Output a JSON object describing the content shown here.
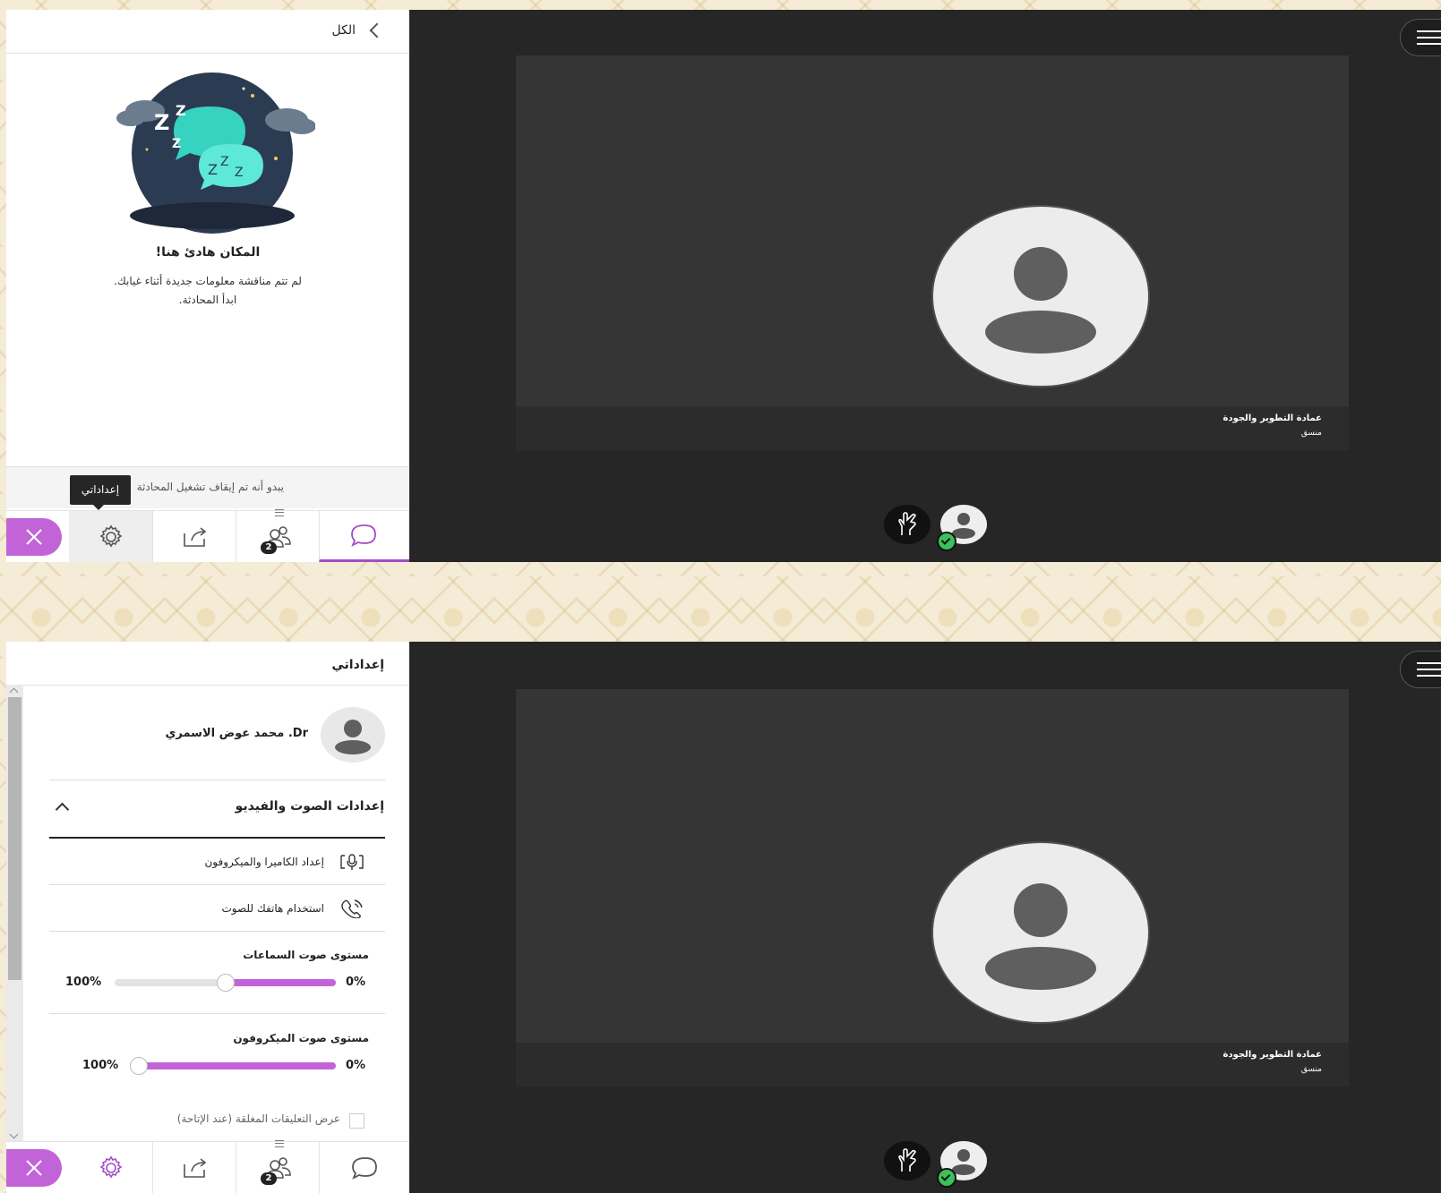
{
  "top": {
    "chat_header": {
      "back_label": "الكل"
    },
    "empty_state": {
      "title": "المكان هادئ هنا!",
      "line1": "لم تتم مناقشة معلومات جديدة أثناء غيابك.",
      "line2": "ابدأ المحادثة."
    },
    "status_text": "يبدو أنه تم إيقاف تشغيل المحادثة",
    "tooltip": "إعداداتي",
    "participants_count": "2",
    "stage": {
      "name": "عمادة التطوير والجودة",
      "role": "منسق"
    }
  },
  "bottom": {
    "panel_title": "إعداداتي",
    "profile_name": "Dr. محمد عوض الاسمري",
    "section_title": "إعدادات الصوت والفيديو",
    "rows": {
      "camera_mic": "إعداد الكاميرا والميكروفون",
      "phone_audio": "استخدام هاتفك للصوت"
    },
    "speaker": {
      "label": "مستوى صوت السماعات",
      "max_label": "100%",
      "min_label": "0%",
      "level_percent": 50
    },
    "microphone": {
      "label": "مستوى صوت الميكروفون",
      "max_label": "100%",
      "min_label": "0%",
      "level_percent": 100
    },
    "captions_label": "عرض التعليقات المغلقة (عند الإتاحة)",
    "participants_count": "2",
    "stage": {
      "name": "عمادة التطوير والجودة",
      "role": "منسق"
    }
  },
  "colors": {
    "accent": "#c264d8",
    "stage_bg": "#262626",
    "tile_bg": "#353535"
  },
  "icons": [
    "chevron-left-icon",
    "close-icon",
    "gear-icon",
    "share-icon",
    "people-icon",
    "chat-icon",
    "hamburger-menu-icon",
    "raise-hand-icon",
    "user-avatar-icon",
    "camera-mic-icon",
    "phone-icon",
    "chevron-up-icon"
  ]
}
